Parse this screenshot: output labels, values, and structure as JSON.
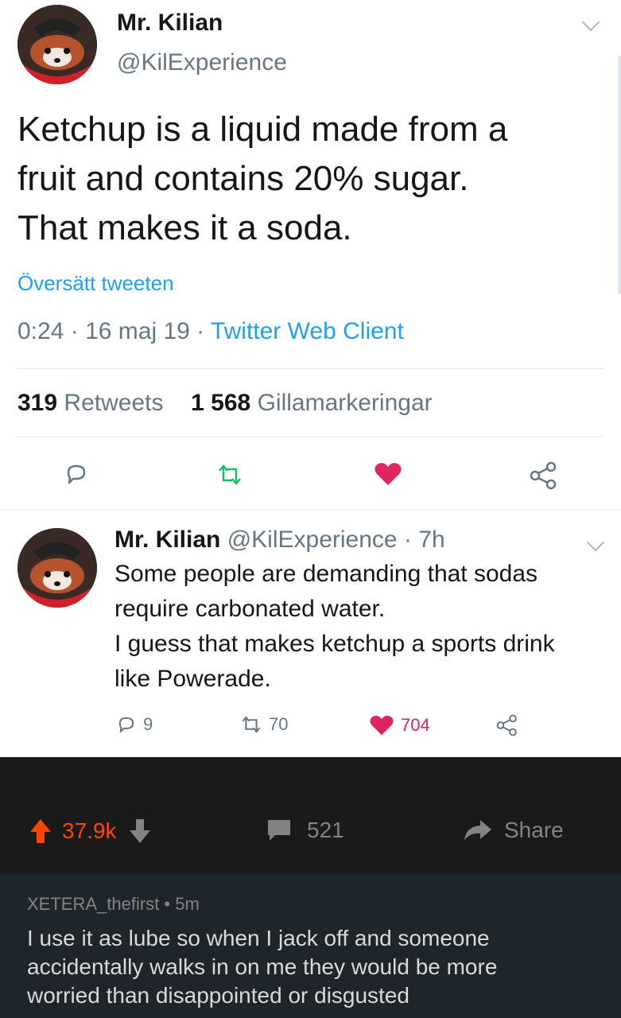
{
  "main_tweet": {
    "author_name": "Mr. Kilian",
    "author_handle": "@KilExperience",
    "text_lines": [
      "Ketchup is a liquid made from a",
      "fruit and contains 20% sugar.",
      "That makes it a soda."
    ],
    "translate_link": "Översätt tweeten",
    "time": "0:24",
    "date": "16 maj 19",
    "client": "Twitter Web Client",
    "retweet_count": "319",
    "retweet_label": "Retweets",
    "like_count": "1 568",
    "like_label": "Gillamarkeringar",
    "icons": {
      "reply": "reply-icon",
      "retweet": "retweet-icon",
      "like": "heart-icon",
      "share": "share-icon"
    },
    "colors": {
      "link": "#1da1f2",
      "retweet": "#17bf63",
      "like": "#e0245e"
    }
  },
  "reply_tweet": {
    "author_name": "Mr. Kilian",
    "author_handle": "@KilExperience",
    "age": "· 7h",
    "text_lines": [
      "Some people are demanding that sodas",
      "require carbonated water.",
      "I guess that makes ketchup a sports drink",
      "like Powerade."
    ],
    "reply_count": "9",
    "retweet_count": "70",
    "like_count": "704"
  },
  "reddit_bar": {
    "score": "37.9k",
    "comments": "521",
    "share_label": "Share",
    "colors": {
      "upvote": "#ff4500",
      "text": "#818384"
    }
  },
  "comment": {
    "username": "XETERA_thefirst",
    "age": "5m",
    "text_lines": [
      "I use it as lube so when I jack off and someone",
      "accidentally walks in on me they would be more",
      "worried than disappointed or disgusted"
    ]
  }
}
